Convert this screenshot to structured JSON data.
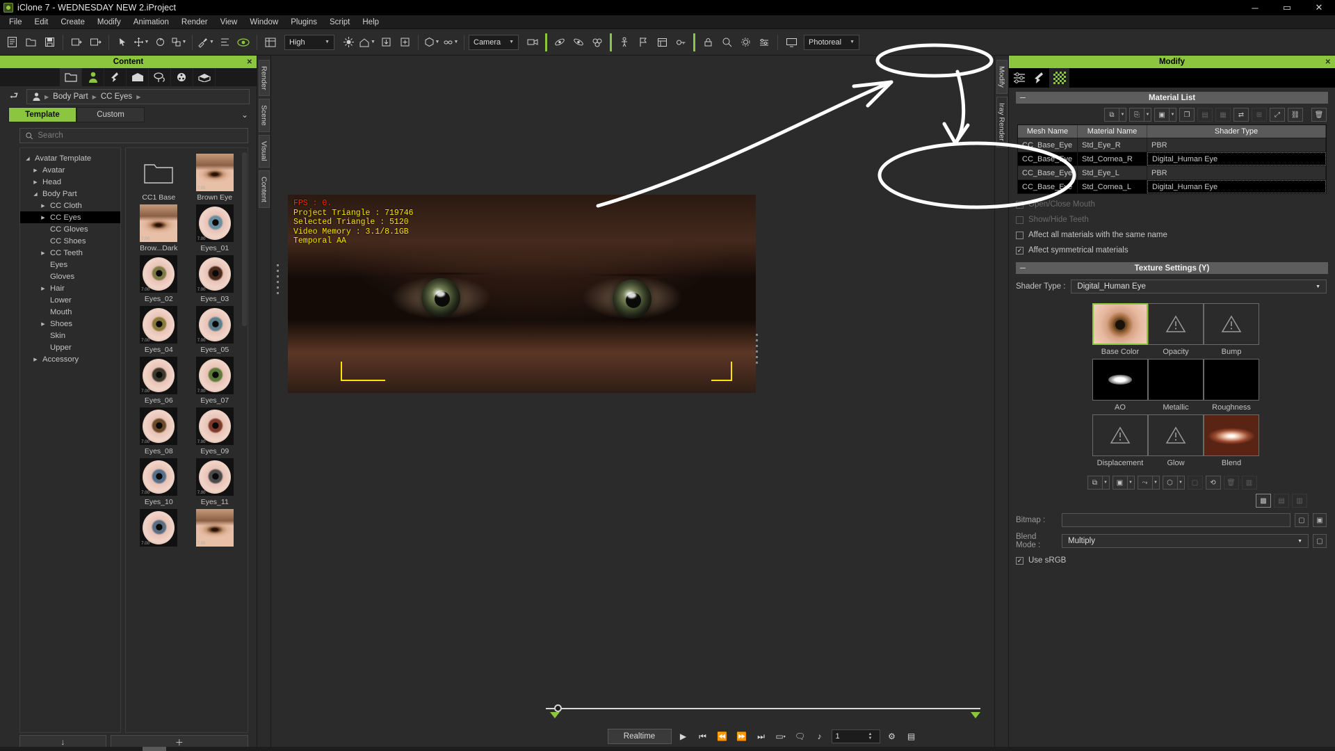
{
  "window": {
    "title": "iClone 7 - WEDNESDAY NEW 2.iProject",
    "minimize": "─",
    "maximize": "▭",
    "close": "✕"
  },
  "menu": [
    "File",
    "Edit",
    "Create",
    "Modify",
    "Animation",
    "Render",
    "View",
    "Window",
    "Plugins",
    "Script",
    "Help"
  ],
  "toolbar": {
    "quality_value": "High",
    "camera_value": "Camera",
    "render_value": "Photoreal",
    "icons": [
      "new-project-icon",
      "open-project-icon",
      "save-project-icon",
      "import-icon",
      "export-icon",
      "undo-icon",
      "redo-icon",
      "select-icon",
      "move-icon",
      "rotate-icon",
      "scale-icon",
      "paint-icon",
      "align-icon",
      "preview-eye-icon",
      "grid-icon",
      "quality-dropdown",
      "light-icon",
      "home-icon",
      "down-icon",
      "add-icon",
      "box-icon",
      "link-icon",
      "camera-dropdown",
      "video-icon",
      "physics-icon",
      "spring-icon",
      "particle-icon",
      "motion-icon",
      "flag-icon",
      "timeline-icon",
      "key-icon",
      "lock-icon",
      "zoom-icon",
      "settings-icon",
      "display-icon",
      "monitor-icon",
      "render-dropdown"
    ]
  },
  "content_panel": {
    "header": "Content",
    "close": "✕",
    "category_tabs": [
      "folder-icon",
      "avatar-icon",
      "motion-icon",
      "scene-icon",
      "prop-icon",
      "media-icon",
      "project-icon"
    ],
    "breadcrumb": [
      "Body Part",
      "CC Eyes"
    ],
    "tabs": {
      "template": "Template",
      "custom": "Custom"
    },
    "search_placeholder": "Search",
    "tree": [
      {
        "label": "Avatar Template",
        "depth": 0,
        "arrow": "down",
        "selected": false
      },
      {
        "label": "Avatar",
        "depth": 1,
        "arrow": "right",
        "selected": false
      },
      {
        "label": "Head",
        "depth": 1,
        "arrow": "right",
        "selected": false
      },
      {
        "label": "Body Part",
        "depth": 1,
        "arrow": "down",
        "selected": false
      },
      {
        "label": "CC Cloth",
        "depth": 2,
        "arrow": "right",
        "selected": false
      },
      {
        "label": "CC Eyes",
        "depth": 2,
        "arrow": "right",
        "selected": true
      },
      {
        "label": "CC Gloves",
        "depth": 2,
        "arrow": "none",
        "selected": false
      },
      {
        "label": "CC Shoes",
        "depth": 2,
        "arrow": "none",
        "selected": false
      },
      {
        "label": "CC Teeth",
        "depth": 2,
        "arrow": "right",
        "selected": false
      },
      {
        "label": "Eyes",
        "depth": 2,
        "arrow": "none",
        "selected": false
      },
      {
        "label": "Gloves",
        "depth": 2,
        "arrow": "none",
        "selected": false
      },
      {
        "label": "Hair",
        "depth": 2,
        "arrow": "right",
        "selected": false
      },
      {
        "label": "Lower",
        "depth": 2,
        "arrow": "none",
        "selected": false
      },
      {
        "label": "Mouth",
        "depth": 2,
        "arrow": "none",
        "selected": false
      },
      {
        "label": "Shoes",
        "depth": 2,
        "arrow": "right",
        "selected": false
      },
      {
        "label": "Skin",
        "depth": 2,
        "arrow": "none",
        "selected": false
      },
      {
        "label": "Upper",
        "depth": 2,
        "arrow": "none",
        "selected": false
      },
      {
        "label": "Accessory",
        "depth": 1,
        "arrow": "right",
        "selected": false
      }
    ],
    "thumbnails": [
      {
        "label": "CC1 Base",
        "type": "folder",
        "version": ""
      },
      {
        "label": "Brown Eye",
        "type": "eyelid",
        "version": "7.00"
      },
      {
        "label": "Brow...Dark",
        "type": "eyelid",
        "version": "7.00"
      },
      {
        "label": "Eyes_01",
        "type": "eyeball",
        "version": "7.00",
        "iris": "#6b8fa0"
      },
      {
        "label": "Eyes_02",
        "type": "eyeball",
        "version": "7.00",
        "iris": "#7d7a45"
      },
      {
        "label": "Eyes_03",
        "type": "eyeball",
        "version": "7.00",
        "iris": "#4a2a1c"
      },
      {
        "label": "Eyes_04",
        "type": "eyeball",
        "version": "7.00",
        "iris": "#8a7a3a"
      },
      {
        "label": "Eyes_05",
        "type": "eyeball",
        "version": "7.00",
        "iris": "#5e7f8d"
      },
      {
        "label": "Eyes_06",
        "type": "eyeball",
        "version": "7.00",
        "iris": "#3d3a2c"
      },
      {
        "label": "Eyes_07",
        "type": "eyeball",
        "version": "7.00",
        "iris": "#5c7a3a"
      },
      {
        "label": "Eyes_08",
        "type": "eyeball",
        "version": "7.00",
        "iris": "#6b4a2c"
      },
      {
        "label": "Eyes_09",
        "type": "eyeball",
        "version": "7.00",
        "iris": "#7d3a2a"
      },
      {
        "label": "Eyes_10",
        "type": "eyeball",
        "version": "7.00",
        "iris": "#56708a"
      },
      {
        "label": "Eyes_11",
        "type": "eyeball",
        "version": "7.00",
        "iris": "#4a4a4a"
      },
      {
        "label": "",
        "type": "eyeball",
        "version": "7.00",
        "iris": "#5a6e84"
      },
      {
        "label": "",
        "type": "eyelid",
        "version": "7.00"
      }
    ],
    "footer": {
      "load_icon": "↓",
      "add_icon": "＋"
    }
  },
  "side_tabs": [
    "Render",
    "Scene",
    "Visual",
    "Content"
  ],
  "right_side_tabs": [
    "Modify",
    "Iray Render"
  ],
  "viewport": {
    "hud": {
      "fps": "FPS : 0.",
      "project_triangle": "Project Triangle : 719746",
      "selected_triangle": "Selected Triangle : 5120",
      "video_memory": "Video Memory : 3.1/8.1GB",
      "aa": "Temporal AA"
    }
  },
  "timeline": {
    "realtime_label": "Realtime",
    "frame_value": "1",
    "transport": [
      "play-icon",
      "jump-start-icon",
      "rewind-icon",
      "fast-forward-icon",
      "jump-end-icon",
      "range-icon",
      "speech-icon",
      "audio-icon"
    ],
    "settings_icon": "gear-icon",
    "list_icon": "list-icon"
  },
  "modify_panel": {
    "header": "Modify",
    "close": "✕",
    "tabs": [
      "sliders-icon",
      "motion-icon",
      "material-checker-icon"
    ],
    "material_list": {
      "title": "Material List",
      "collapse": "─",
      "columns": [
        "Mesh Name",
        "Material Name",
        "Shader Type"
      ],
      "rows": [
        {
          "mesh": "CC_Base_Eye",
          "material": "Std_Eye_R",
          "shader": "PBR",
          "selected": false
        },
        {
          "mesh": "CC_Base_Eye",
          "material": "Std_Cornea_R",
          "shader": "Digital_Human Eye",
          "selected": true
        },
        {
          "mesh": "CC_Base_Eye",
          "material": "Std_Eye_L",
          "shader": "PBR",
          "selected": false
        },
        {
          "mesh": "CC_Base_Eye",
          "material": "Std_Cornea_L",
          "shader": "Digital_Human Eye",
          "selected": true
        }
      ],
      "tools": [
        "copy-material-icon",
        "paste-material-icon",
        "save-material-icon",
        "duplicate-icon",
        "delete-layer-icon",
        "grid-icon",
        "swap-icon",
        "merge-icon",
        "pick-icon",
        "link-icon",
        "trash-icon"
      ]
    },
    "checkboxes": [
      {
        "label": "Open/Close Mouth",
        "checked": false,
        "disabled": true
      },
      {
        "label": "Show/Hide Teeth",
        "checked": false,
        "disabled": true
      },
      {
        "label": "Affect all materials with the same name",
        "checked": false,
        "disabled": false
      },
      {
        "label": "Affect symmetrical materials",
        "checked": true,
        "disabled": false
      }
    ],
    "texture_settings": {
      "title": "Texture Settings  (Y)",
      "collapse": "─",
      "shader_type_label": "Shader Type :",
      "shader_type_value": "Digital_Human Eye",
      "maps": [
        {
          "label": "Base Color",
          "kind": "basecolor",
          "selected": true
        },
        {
          "label": "Opacity",
          "kind": "warning",
          "selected": false
        },
        {
          "label": "Bump",
          "kind": "warning",
          "selected": false
        },
        {
          "label": "AO",
          "kind": "ao",
          "selected": false
        },
        {
          "label": "Metallic",
          "kind": "black",
          "selected": false
        },
        {
          "label": "Roughness",
          "kind": "black",
          "selected": false
        },
        {
          "label": "Displacement",
          "kind": "warning",
          "selected": false
        },
        {
          "label": "Glow",
          "kind": "warning",
          "selected": false
        },
        {
          "label": "Blend",
          "kind": "blend",
          "selected": false
        }
      ],
      "bitmap_label": "Bitmap :",
      "bitmap_value": "",
      "blend_mode_label": "Blend Mode :",
      "blend_mode_value": "Multiply",
      "use_srgb_label": "Use sRGB",
      "use_srgb_checked": true
    }
  },
  "colors": {
    "accent": "#8cc63e",
    "panel_bg": "#2b2b2b",
    "header_text": "#000000",
    "hud_yellow": "#ffe400",
    "hud_red": "#ff2a00"
  }
}
